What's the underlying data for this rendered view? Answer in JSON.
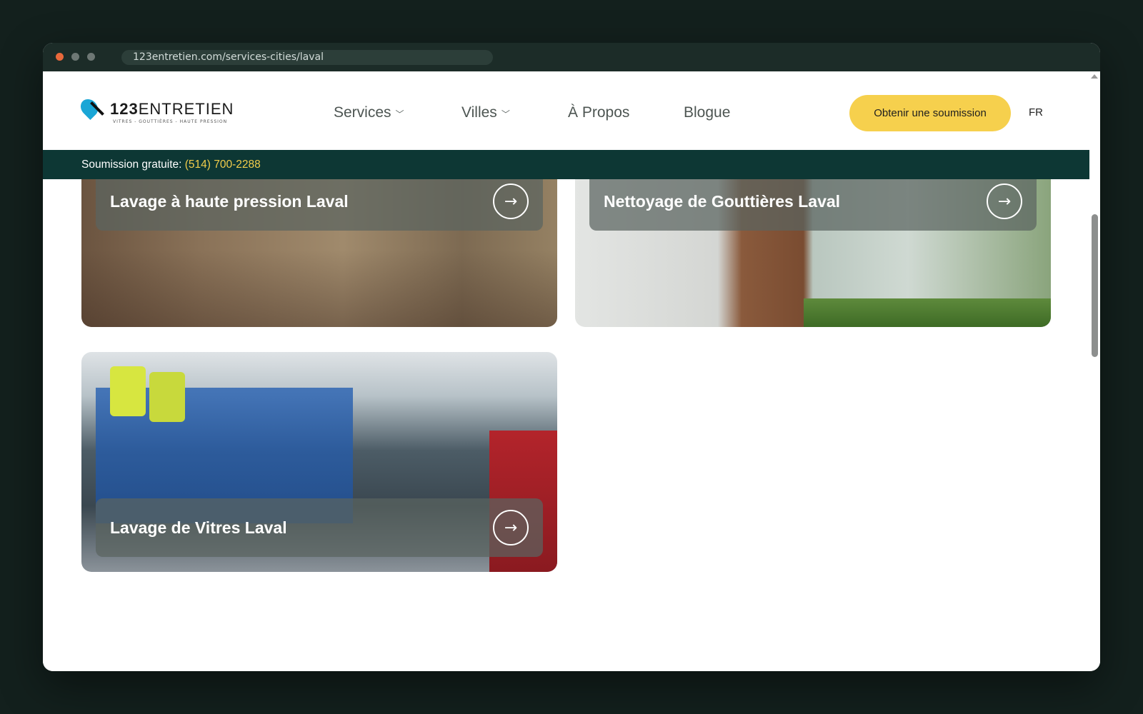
{
  "browser": {
    "url": "123entretien.com/services-cities/laval"
  },
  "header": {
    "logo": {
      "wordmark_bold": "123",
      "wordmark": "ENTRETIEN",
      "tagline": "VITRES - GOUTTIÈRES - HAUTE PRESSION"
    },
    "nav": [
      {
        "label": "Services",
        "has_dropdown": true
      },
      {
        "label": "Villes",
        "has_dropdown": true
      },
      {
        "label": "À Propos",
        "has_dropdown": false
      },
      {
        "label": "Blogue",
        "has_dropdown": false
      }
    ],
    "cta_label": "Obtenir une soumission",
    "language": "FR"
  },
  "phonebar": {
    "label": "Soumission gratuite:",
    "phone": "(514) 700-2288"
  },
  "cards": [
    {
      "title": "Lavage à haute pression Laval",
      "icon": "arrow-right-icon"
    },
    {
      "title": "Nettoyage de Gouttières Laval",
      "icon": "arrow-right-icon"
    },
    {
      "title": "Lavage de Vitres Laval",
      "icon": "arrow-right-icon"
    }
  ],
  "colors": {
    "accent": "#f6d04d",
    "phonebar_bg": "#0d3734",
    "phone_text": "#f2cd4b"
  }
}
